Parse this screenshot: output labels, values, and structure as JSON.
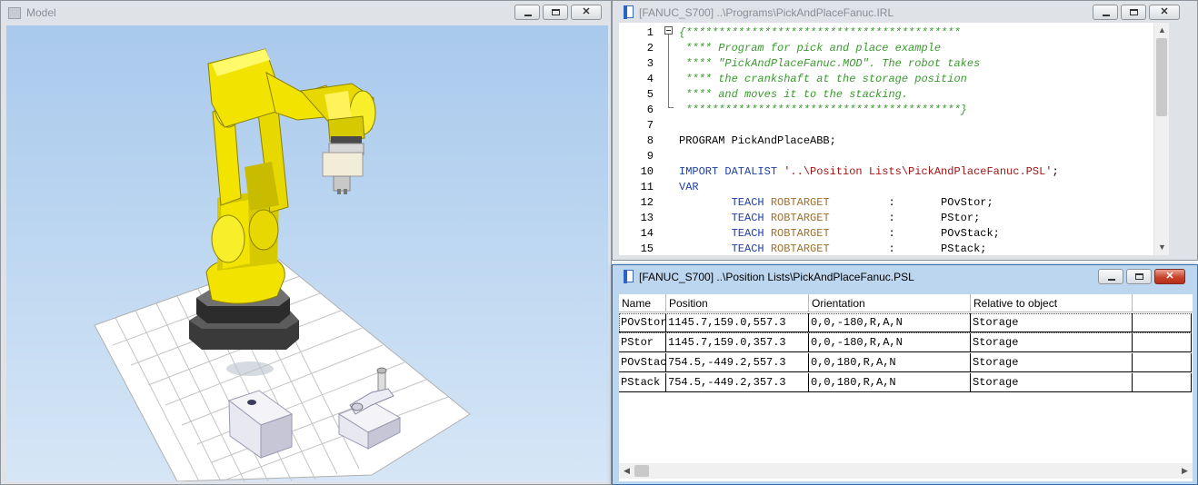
{
  "model_window": {
    "title": "Model"
  },
  "program_window": {
    "title": "[FANUC_S700] ..\\Programs\\PickAndPlaceFanuc.IRL",
    "code_lines": [
      {
        "num": "1",
        "parts": [
          {
            "t": "{******************************************",
            "c": "cm"
          }
        ]
      },
      {
        "num": "2",
        "parts": [
          {
            "t": " **** Program for pick and place example",
            "c": "cm"
          }
        ]
      },
      {
        "num": "3",
        "parts": [
          {
            "t": " **** \"PickAndPlaceFanuc.MOD\". The robot takes",
            "c": "cm"
          }
        ]
      },
      {
        "num": "4",
        "parts": [
          {
            "t": " **** the crankshaft at the storage position",
            "c": "cm"
          }
        ]
      },
      {
        "num": "5",
        "parts": [
          {
            "t": " **** and moves it to the stacking.",
            "c": "cm"
          }
        ]
      },
      {
        "num": "6",
        "parts": [
          {
            "t": " ******************************************}",
            "c": "cm"
          }
        ]
      },
      {
        "num": "7",
        "parts": []
      },
      {
        "num": "8",
        "parts": [
          {
            "t": "PROGRAM PickAndPlaceABB;",
            "c": ""
          }
        ]
      },
      {
        "num": "9",
        "parts": []
      },
      {
        "num": "10",
        "parts": [
          {
            "t": "IMPORT DATALIST ",
            "c": "kw"
          },
          {
            "t": "'..\\Position Lists\\PickAndPlaceFanuc.PSL'",
            "c": "st"
          },
          {
            "t": ";",
            "c": ""
          }
        ]
      },
      {
        "num": "11",
        "parts": [
          {
            "t": "VAR",
            "c": "kw"
          }
        ]
      },
      {
        "num": "12",
        "parts": [
          {
            "t": "        TEACH ",
            "c": "kw"
          },
          {
            "t": "ROBTARGET",
            "c": "ty"
          },
          {
            "t": "         :       POvStor;",
            "c": ""
          }
        ]
      },
      {
        "num": "13",
        "parts": [
          {
            "t": "        TEACH ",
            "c": "kw"
          },
          {
            "t": "ROBTARGET",
            "c": "ty"
          },
          {
            "t": "         :       PStor;",
            "c": ""
          }
        ]
      },
      {
        "num": "14",
        "parts": [
          {
            "t": "        TEACH ",
            "c": "kw"
          },
          {
            "t": "ROBTARGET",
            "c": "ty"
          },
          {
            "t": "         :       POvStack;",
            "c": ""
          }
        ]
      },
      {
        "num": "15",
        "parts": [
          {
            "t": "        TEACH ",
            "c": "kw"
          },
          {
            "t": "ROBTARGET",
            "c": "ty"
          },
          {
            "t": "         :       PStack;",
            "c": ""
          }
        ]
      }
    ]
  },
  "position_window": {
    "title": "[FANUC_S700] ..\\Position Lists\\PickAndPlaceFanuc.PSL",
    "columns": [
      "Name",
      "Position",
      "Orientation",
      "Relative to object"
    ],
    "rows": [
      {
        "name": "POvStor",
        "position": "1145.7,159.0,557.3",
        "orientation": "0,0,-180,R,A,N",
        "relative": "Storage"
      },
      {
        "name": "PStor",
        "position": "1145.7,159.0,357.3",
        "orientation": "0,0,-180,R,A,N",
        "relative": "Storage"
      },
      {
        "name": "POvStack",
        "position": "754.5,-449.2,557.3",
        "orientation": "0,0,180,R,A,N",
        "relative": "Storage"
      },
      {
        "name": "PStack",
        "position": "754.5,-449.2,357.3",
        "orientation": "0,0,180,R,A,N",
        "relative": "Storage"
      }
    ]
  },
  "icons": {
    "model_window_icon": "window-icon",
    "document_icon": "document-icon",
    "minimize": "minimize-icon",
    "maximize": "maximize-icon",
    "close": "close-icon"
  },
  "colors": {
    "robot_yellow": "#f2e400",
    "comment_green": "#3a9a2e",
    "keyword_blue": "#1e3fa8",
    "type_brown": "#a0702c",
    "string_red": "#a31515",
    "active_title": "#bdd6ef",
    "close_red": "#c7432c"
  }
}
